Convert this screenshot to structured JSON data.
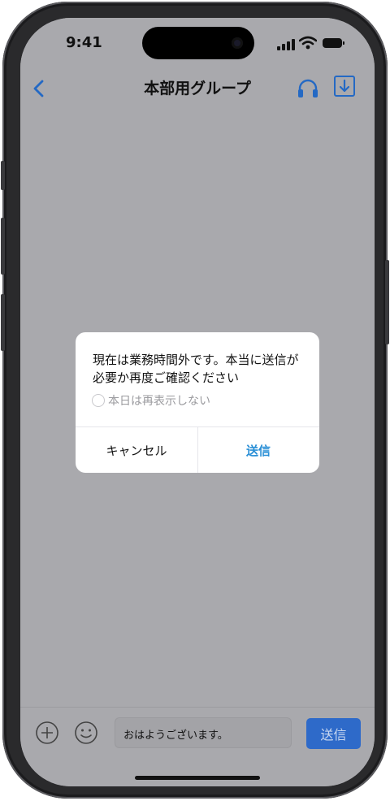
{
  "status_bar": {
    "time": "9:41"
  },
  "header": {
    "title": "本部用グループ",
    "back_icon": "chevron-left-icon",
    "headphones_icon": "headphones-icon",
    "download_icon": "download-icon"
  },
  "dialog": {
    "message": "現在は業務時間外です。本当に送信が必要か再度ご確認ください",
    "checkbox_label": "本日は再表示しない",
    "cancel_label": "キャンセル",
    "send_label": "送信"
  },
  "composer": {
    "message_value": "おはようございます。",
    "send_label": "送信",
    "add_icon": "plus-circle-icon",
    "emoji_icon": "smiley-icon"
  },
  "colors": {
    "accent": "#2a8fd6",
    "send_button": "#2e6ac9",
    "dim_overlay": "#a9a9ad"
  }
}
